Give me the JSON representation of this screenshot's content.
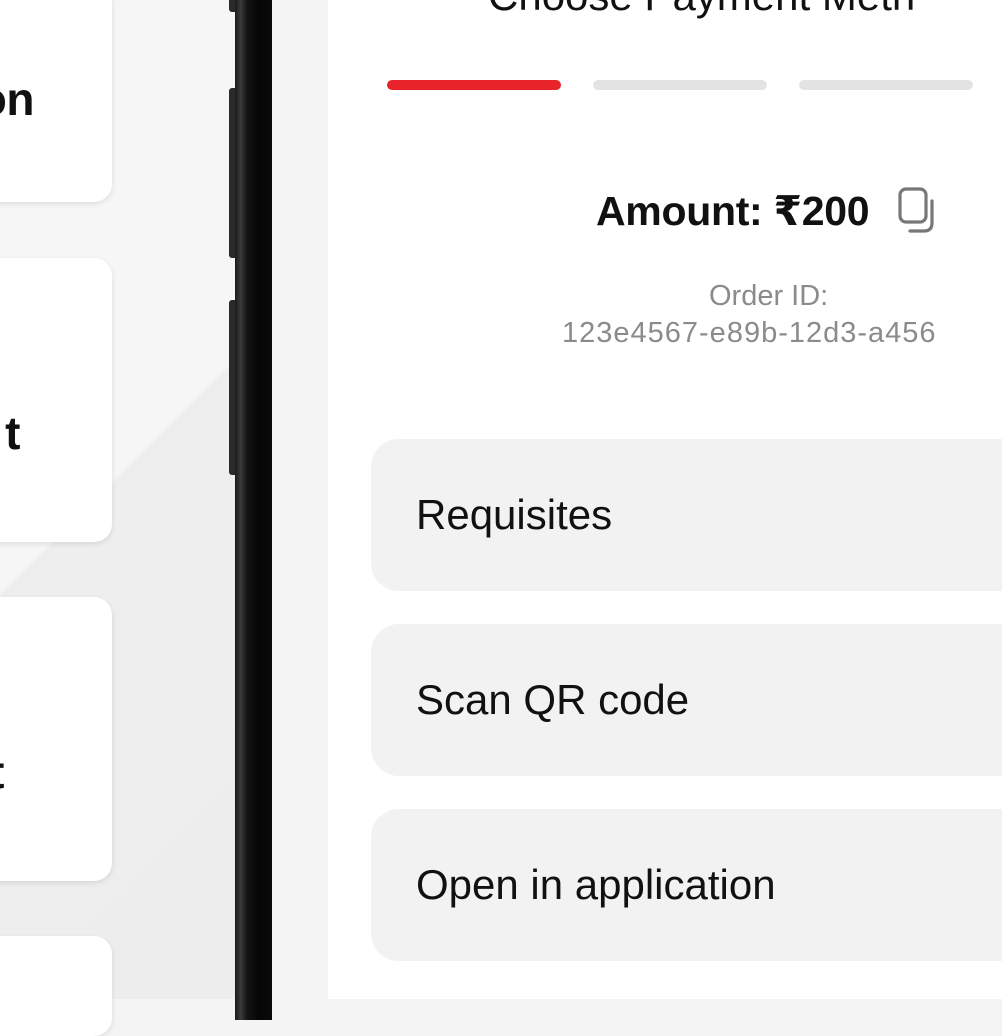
{
  "background_cards": {
    "card1_text": "on",
    "card2_text": "t",
    "card3_text": "t",
    "card4_text": ""
  },
  "screen": {
    "title": "Choose Payment Meth",
    "progress_steps": [
      {
        "state": "active",
        "color": "#e8232a"
      },
      {
        "state": "inactive",
        "color": "#e3e3e3"
      },
      {
        "state": "inactive",
        "color": "#e3e3e3"
      }
    ],
    "amount_label": "Amount: ₹200",
    "copy_icon": "copy-icon",
    "order_label": "Order ID:",
    "order_value": "123e4567-e89b-12d3-a456",
    "methods": [
      {
        "label": "Requisites"
      },
      {
        "label": "Scan QR code"
      },
      {
        "label": "Open in application"
      }
    ]
  },
  "colors": {
    "accent": "#e8232a",
    "inactive_step": "#e3e3e3",
    "method_bg": "#f2f2f2",
    "muted_text": "#8b8b8b"
  }
}
